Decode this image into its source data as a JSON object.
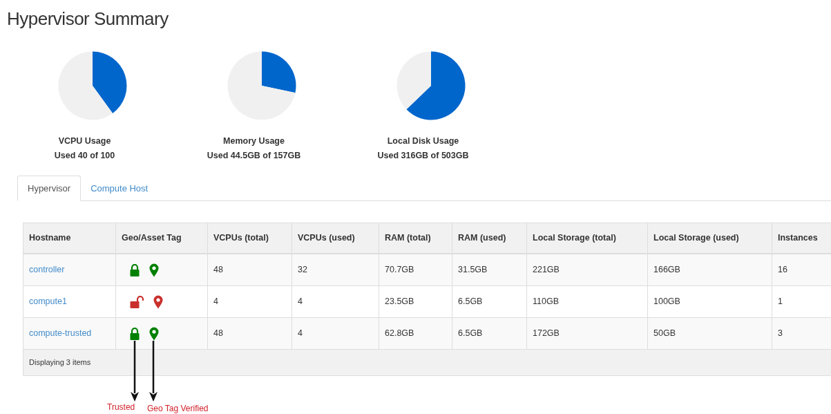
{
  "title": "Hypervisor Summary",
  "usage": [
    {
      "name": "VCPU Usage",
      "reading": "Used 40 of 100",
      "chart_data": {
        "type": "pie",
        "values": [
          40,
          60
        ]
      }
    },
    {
      "name": "Memory Usage",
      "reading": "Used 44.5GB of 157GB",
      "chart_data": {
        "type": "pie",
        "values": [
          28.3,
          71.7
        ]
      }
    },
    {
      "name": "Local Disk Usage",
      "reading": "Used 316GB of 503GB",
      "chart_data": {
        "type": "pie",
        "values": [
          62.8,
          37.2
        ]
      }
    }
  ],
  "tabs": [
    {
      "label": "Hypervisor",
      "selected": true
    },
    {
      "label": "Compute Host",
      "selected": false
    }
  ],
  "table": {
    "columns": [
      "Hostname",
      "Geo/Asset Tag",
      "VCPUs (total)",
      "VCPUs (used)",
      "RAM (total)",
      "RAM (used)",
      "Local Storage (total)",
      "Local Storage (used)",
      "Instances"
    ],
    "rows": [
      {
        "cells": [
          "controller",
          {
            "trusted": true,
            "geo_verified": true
          },
          "48",
          "32",
          "70.7GB",
          "31.5GB",
          "221GB",
          "166GB",
          "16"
        ]
      },
      {
        "cells": [
          "compute1",
          {
            "trusted": false,
            "geo_verified": false
          },
          "4",
          "4",
          "23.5GB",
          "6.5GB",
          "110GB",
          "100GB",
          "1"
        ]
      },
      {
        "cells": [
          "compute-trusted",
          {
            "trusted": true,
            "geo_verified": true
          },
          "48",
          "4",
          "62.8GB",
          "6.5GB",
          "172GB",
          "50GB",
          "3"
        ]
      }
    ],
    "footer": "Displaying 3 items"
  },
  "annotations": [
    "Trusted",
    "Geo Tag Verified"
  ]
}
